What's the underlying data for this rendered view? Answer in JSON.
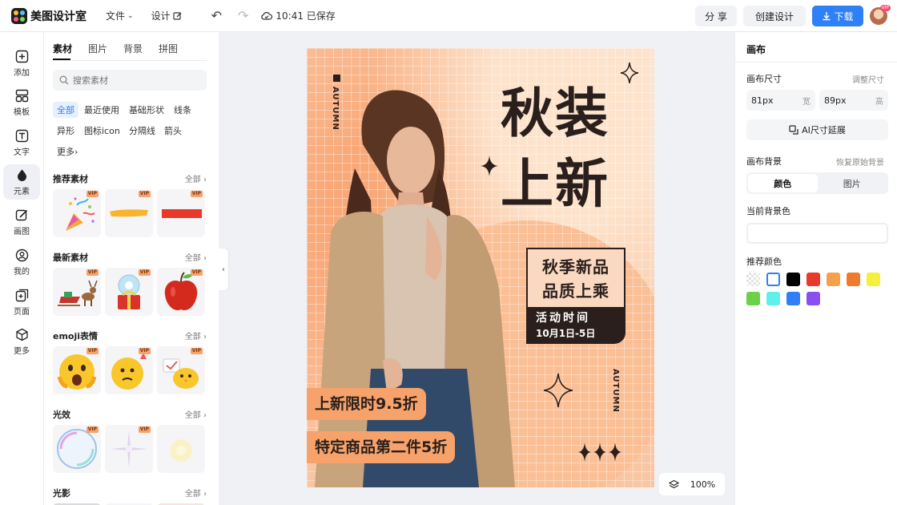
{
  "app": {
    "name": "美图设计室",
    "menu_file": "文件",
    "menu_design": "设计",
    "save_status": "10:41 已保存",
    "share_label": "分 享",
    "create_label": "创建设计",
    "download_label": "下载",
    "avatar_badge": "VIP"
  },
  "rail": [
    {
      "label": "添加",
      "icon": "plus-square-icon"
    },
    {
      "label": "模板",
      "icon": "template-icon"
    },
    {
      "label": "文字",
      "icon": "text-icon"
    },
    {
      "label": "元素",
      "icon": "shapes-icon",
      "active": true
    },
    {
      "label": "画图",
      "icon": "draw-icon"
    },
    {
      "label": "我的",
      "icon": "user-icon"
    },
    {
      "label": "页面",
      "icon": "page-add-icon"
    },
    {
      "label": "更多",
      "icon": "cube-icon"
    }
  ],
  "panel": {
    "tabs": [
      "素材",
      "图片",
      "背景",
      "拼图"
    ],
    "search_placeholder": "搜索素材",
    "chips": [
      "全部",
      "最近使用",
      "基础形状",
      "线条",
      "异形",
      "图标icon",
      "分隔线",
      "箭头",
      "更多"
    ],
    "see_all": "全部",
    "vip": "VIP",
    "sections": [
      "推荐素材",
      "最新素材",
      "emoji表情",
      "光效",
      "光影"
    ]
  },
  "poster": {
    "title_line1": "秋装",
    "title_line2": "上新",
    "side_text": "AUTUMN",
    "box_line1": "秋季新品",
    "box_line2": "品质上乘",
    "event_title": "活动时间",
    "event_date": "10月1日-5日",
    "promo1": "上新限时9.5折",
    "promo2": "特定商品第二件5折"
  },
  "zoom": "100%",
  "inspector": {
    "title": "画布",
    "size_label": "画布尺寸",
    "size_link": "调整尺寸",
    "width_value": "81px",
    "width_unit": "宽",
    "height_value": "89px",
    "height_unit": "高",
    "ai_button": "AI尺寸延展",
    "bg_label": "画布背景",
    "bg_reset": "恢复原始背景",
    "seg_color": "颜色",
    "seg_image": "图片",
    "current_color_label": "当前背景色",
    "recommend_label": "推荐颜色",
    "swatches": [
      "transparent",
      "#ffffff",
      "#000000",
      "#e8392b",
      "#f5a14c",
      "#ee7a2e",
      "#f5ef3e",
      "#6bd146",
      "#5ff0ee",
      "#2f7ff6",
      "#8a4ff0"
    ]
  }
}
